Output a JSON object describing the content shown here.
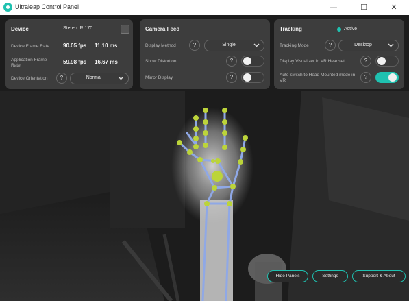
{
  "window": {
    "title": "Ultraleap Control Panel",
    "minimize_glyph": "—",
    "maximize_glyph": "☐",
    "close_glyph": "✕"
  },
  "device": {
    "heading": "Device",
    "device_name": "Stereo IR 170",
    "frame_rate_label": "Device Frame Rate",
    "frame_rate_fps": "90.05 fps",
    "frame_rate_ms": "11.10 ms",
    "app_frame_rate_label": "Application Frame Rate",
    "app_frame_rate_fps": "59.98 fps",
    "app_frame_rate_ms": "16.67 ms",
    "orientation_label": "Device Orientation",
    "orientation_value": "Normal"
  },
  "camera_feed": {
    "heading": "Camera Feed",
    "display_method_label": "Display Method",
    "display_method_value": "Single",
    "show_distortion_label": "Show Distortion",
    "show_distortion_on": false,
    "mirror_display_label": "Mirror Display",
    "mirror_display_on": false
  },
  "tracking": {
    "heading": "Tracking",
    "status": "Active",
    "status_color": "#1fc1b0",
    "mode_label": "Tracking Mode",
    "mode_value": "Desktop",
    "vr_viz_label": "Display Visualizer in VR Headset",
    "vr_viz_on": false,
    "auto_switch_label": "Auto-switch to Head Mounted mode in VR",
    "auto_switch_on": true
  },
  "help_glyph": "?",
  "bottom_buttons": {
    "hide_panels": "Hide Panels",
    "settings": "Settings",
    "support": "Support & About"
  },
  "colors": {
    "accent": "#1fc1b0",
    "joint": "#bcd43a",
    "bone": "#8fa8e6"
  }
}
